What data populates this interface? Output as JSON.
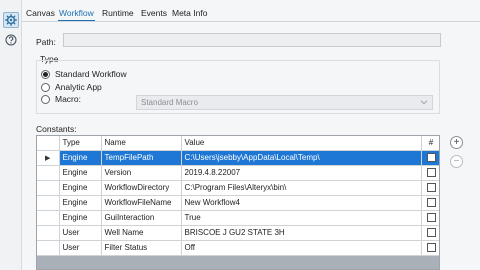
{
  "tabs": [
    {
      "label": "Canvas",
      "active": false
    },
    {
      "label": "Workflow",
      "active": true
    },
    {
      "label": "Runtime",
      "active": false
    },
    {
      "label": "Events",
      "active": false
    },
    {
      "label": "Meta Info",
      "active": false
    }
  ],
  "leftbar": {
    "settings_icon": "gear-icon",
    "help_icon": "help-icon"
  },
  "path": {
    "label": "Path:",
    "value": ""
  },
  "type": {
    "label": "Type",
    "options": [
      {
        "label": "Standard Workflow",
        "selected": true
      },
      {
        "label": "Analytic App",
        "selected": false
      },
      {
        "label": "Macro:",
        "selected": false
      }
    ],
    "macro_select": {
      "value": "Standard Macro",
      "enabled": false
    }
  },
  "constants": {
    "label": "Constants:",
    "columns": [
      "Type",
      "Name",
      "Value",
      "#"
    ],
    "rows": [
      {
        "type": "Engine",
        "name": "TempFilePath",
        "value": "C:\\Users\\jsebby\\AppData\\Local\\Temp\\",
        "checked": false,
        "selected": true
      },
      {
        "type": "Engine",
        "name": "Version",
        "value": "2019.4.8.22007",
        "checked": false,
        "selected": false
      },
      {
        "type": "Engine",
        "name": "WorkflowDirectory",
        "value": "C:\\Program Files\\Alteryx\\bin\\",
        "checked": false,
        "selected": false
      },
      {
        "type": "Engine",
        "name": "WorkflowFileName",
        "value": "New Workflow4",
        "checked": false,
        "selected": false
      },
      {
        "type": "Engine",
        "name": "GuiInteraction",
        "value": "True",
        "checked": false,
        "selected": false
      },
      {
        "type": "User",
        "name": "Well Name",
        "value": "BRISCOE J GU2 STATE 3H",
        "checked": false,
        "selected": false
      },
      {
        "type": "User",
        "name": "Filter Status",
        "value": "Off",
        "checked": false,
        "selected": false
      }
    ]
  },
  "side_buttons": {
    "add": "+",
    "remove": "−"
  },
  "colors": {
    "accent": "#1f6fb5",
    "selection": "#1e77d4"
  }
}
